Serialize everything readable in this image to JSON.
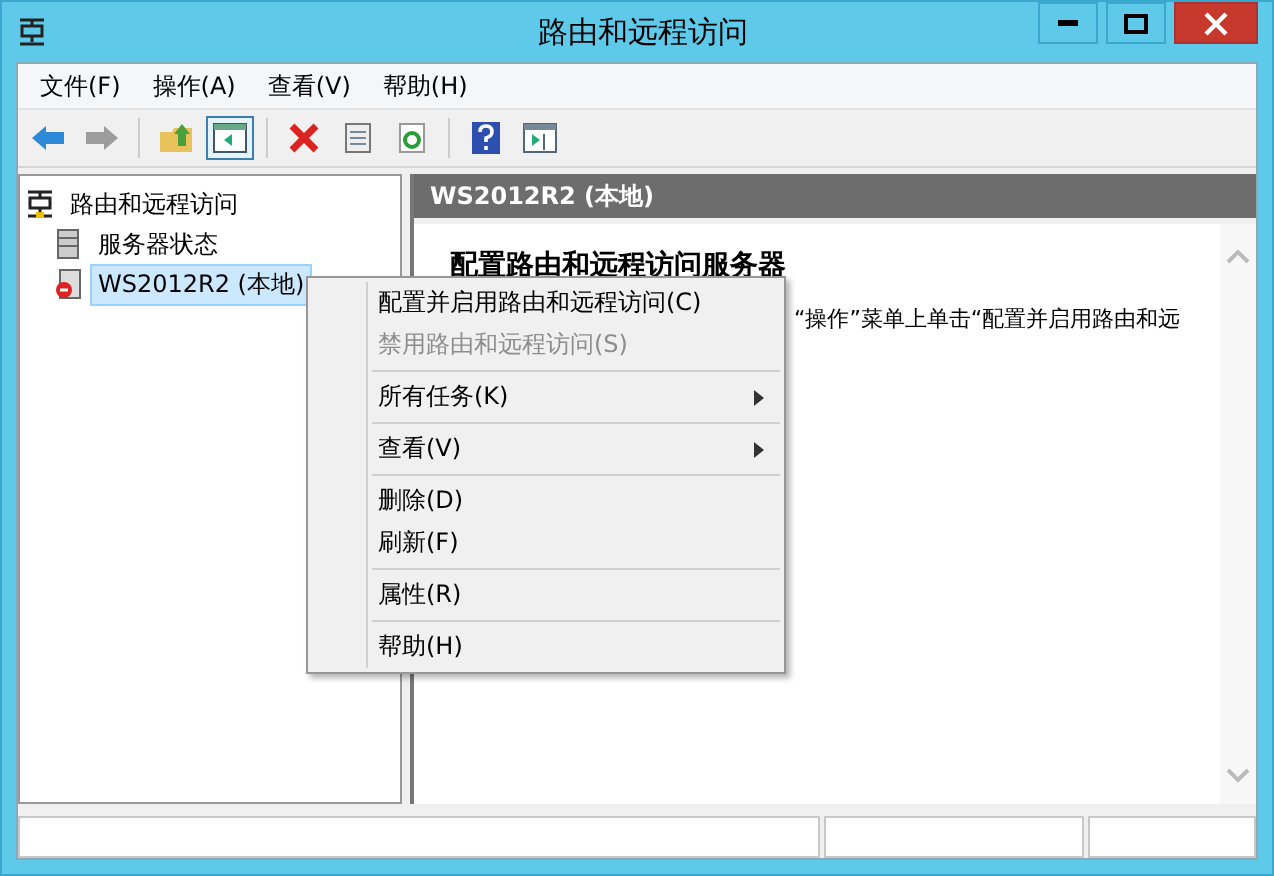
{
  "window": {
    "title": "路由和远程访问"
  },
  "menu_bar": [
    "文件(F)",
    "操作(A)",
    "查看(V)",
    "帮助(H)"
  ],
  "toolbar": [
    {
      "disabled": false,
      "pressed": false
    },
    {
      "disabled": true,
      "pressed": false
    },
    {
      "disabled": false,
      "pressed": false
    },
    {
      "disabled": false,
      "pressed": true
    },
    {
      "disabled": false,
      "pressed": false
    },
    {
      "disabled": false,
      "pressed": false
    },
    {
      "disabled": false,
      "pressed": false
    },
    {
      "disabled": false,
      "pressed": false
    },
    {
      "disabled": false,
      "pressed": false
    }
  ],
  "tree": [
    {
      "label": "路由和远程访问",
      "selected": false,
      "children": [
        {
          "label": "服务器状态",
          "selected": false
        },
        {
          "label": "WS2012R2 (本地)",
          "selected": true
        }
      ]
    }
  ],
  "detail": {
    "header": "WS2012R2 (本地)",
    "heading": "配置路由和远程访问服务器",
    "text": "“操作”菜单上单击“配置并启用路由和远"
  },
  "context_menu": [
    {
      "kind": "item",
      "label": "配置并启用路由和远程访问(C)",
      "disabled": false,
      "submenu": false
    },
    {
      "kind": "item",
      "label": "禁用路由和远程访问(S)",
      "disabled": true,
      "submenu": false
    },
    {
      "kind": "separator"
    },
    {
      "kind": "item",
      "label": "所有任务(K)",
      "disabled": false,
      "submenu": true
    },
    {
      "kind": "separator"
    },
    {
      "kind": "item",
      "label": "查看(V)",
      "disabled": false,
      "submenu": true
    },
    {
      "kind": "separator"
    },
    {
      "kind": "item",
      "label": "删除(D)",
      "disabled": false,
      "submenu": false
    },
    {
      "kind": "item",
      "label": "刷新(F)",
      "disabled": false,
      "submenu": false
    },
    {
      "kind": "separator"
    },
    {
      "kind": "item",
      "label": "属性(R)",
      "disabled": false,
      "submenu": false
    },
    {
      "kind": "separator"
    },
    {
      "kind": "item",
      "label": "帮助(H)",
      "disabled": false,
      "submenu": false
    }
  ]
}
